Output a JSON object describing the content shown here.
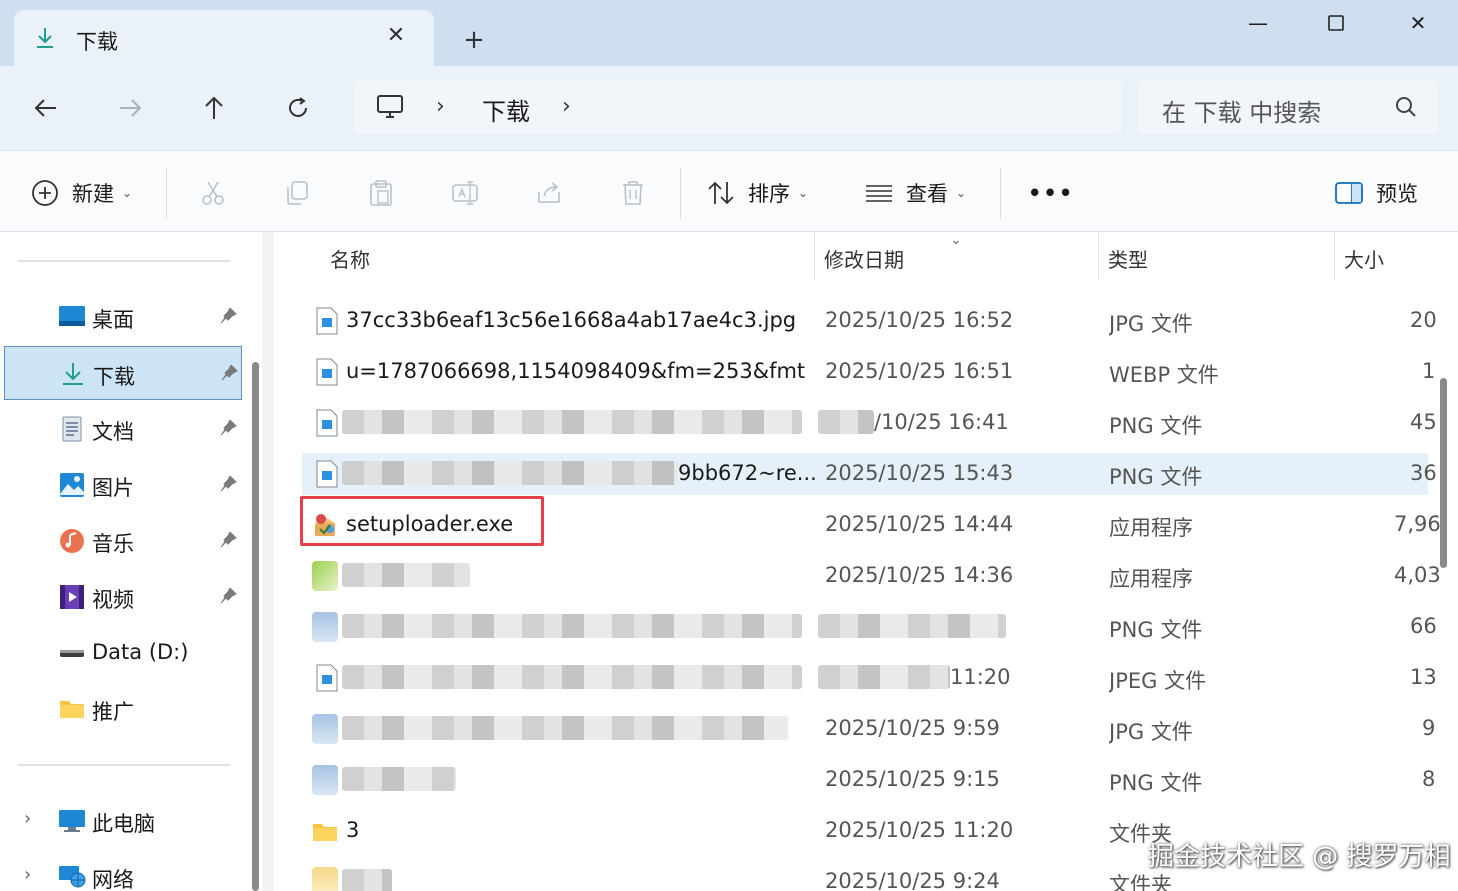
{
  "tab": {
    "title": "下载"
  },
  "address": {
    "crumbs": [
      "下载"
    ]
  },
  "search": {
    "placeholder": "在 下载 中搜索"
  },
  "toolbar": {
    "new_label": "新建",
    "sort_label": "排序",
    "view_label": "查看",
    "more_label": "•••",
    "preview_label": "预览"
  },
  "sidebar": {
    "items": [
      {
        "label": "桌面",
        "icon": "desktop-icon"
      },
      {
        "label": "下载",
        "icon": "download-icon"
      },
      {
        "label": "文档",
        "icon": "document-icon"
      },
      {
        "label": "图片",
        "icon": "picture-icon"
      },
      {
        "label": "音乐",
        "icon": "music-icon"
      },
      {
        "label": "视频",
        "icon": "video-icon"
      },
      {
        "label": "Data (D:)",
        "icon": "drive-icon"
      },
      {
        "label": "推广",
        "icon": "folder-icon"
      }
    ],
    "this_pc": "此电脑",
    "network": "网络"
  },
  "columns": {
    "name": "名称",
    "date": "修改日期",
    "type": "类型",
    "size": "大小"
  },
  "files": [
    {
      "name": "37cc33b6eaf13c56e1668a4ab17ae4c3.jpg",
      "date": "2025/10/25 16:52",
      "type": "JPG 文件",
      "size": "20"
    },
    {
      "name": "u=1787066698,1154098409&fm=253&fmt=...",
      "date": "2025/10/25 16:51",
      "type": "WEBP 文件",
      "size": "1"
    },
    {
      "name": "",
      "date": "/10/25 16:41",
      "type": "PNG 文件",
      "size": "45"
    },
    {
      "name": "9bb672~re...",
      "date": "2025/10/25 15:43",
      "type": "PNG 文件",
      "size": "36"
    },
    {
      "name": "setuploader.exe",
      "date": "2025/10/25 14:44",
      "type": "应用程序",
      "size": "7,96"
    },
    {
      "name": "",
      "date": "2025/10/25 14:36",
      "type": "应用程序",
      "size": "4,03"
    },
    {
      "name": "",
      "date": "",
      "type": "PNG 文件",
      "size": "66"
    },
    {
      "name": "",
      "date": "11:20",
      "type": "JPEG 文件",
      "size": "13"
    },
    {
      "name": "",
      "date": "2025/10/25 9:59",
      "type": "JPG 文件",
      "size": "9"
    },
    {
      "name": "",
      "date": "2025/10/25 9:15",
      "type": "PNG 文件",
      "size": "8"
    },
    {
      "name": "3",
      "date": "2025/10/25 11:20",
      "type": "文件夹",
      "size": ""
    },
    {
      "name": "",
      "date": "2025/10/25 9:24",
      "type": "文件夹",
      "size": ""
    }
  ],
  "watermark": "掘金技术社区 @ 搜罗万相",
  "colors": {
    "accent": "#0f6cbd",
    "selection": "#cde4f7",
    "highlight": "#e5404a",
    "titlebar": "#cfdff0"
  }
}
